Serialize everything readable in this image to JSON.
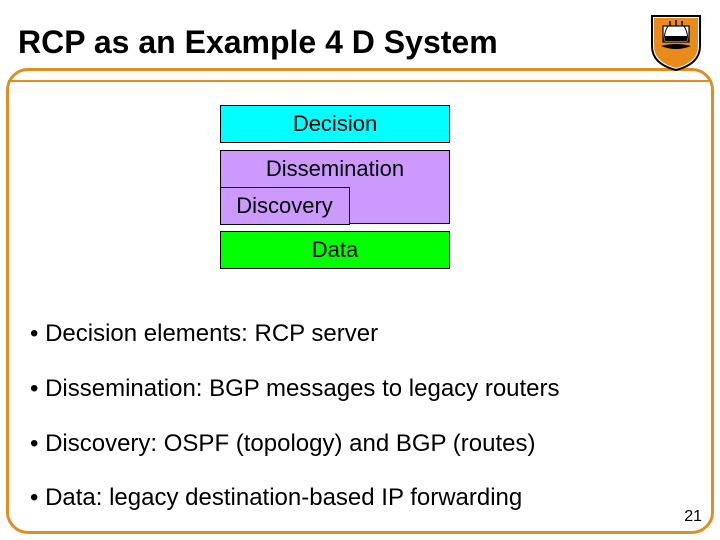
{
  "title": "RCP as an Example 4 D System",
  "layers": {
    "decision": "Decision",
    "dissemination": "Dissemination",
    "discovery": "Discovery",
    "data": "Data"
  },
  "bullets": [
    "• Decision elements: RCP server",
    "• Dissemination: BGP messages to legacy routers",
    "• Discovery: OSPF (topology) and BGP (routes)",
    "• Data: legacy destination-based IP forwarding"
  ],
  "pagenum": "21"
}
